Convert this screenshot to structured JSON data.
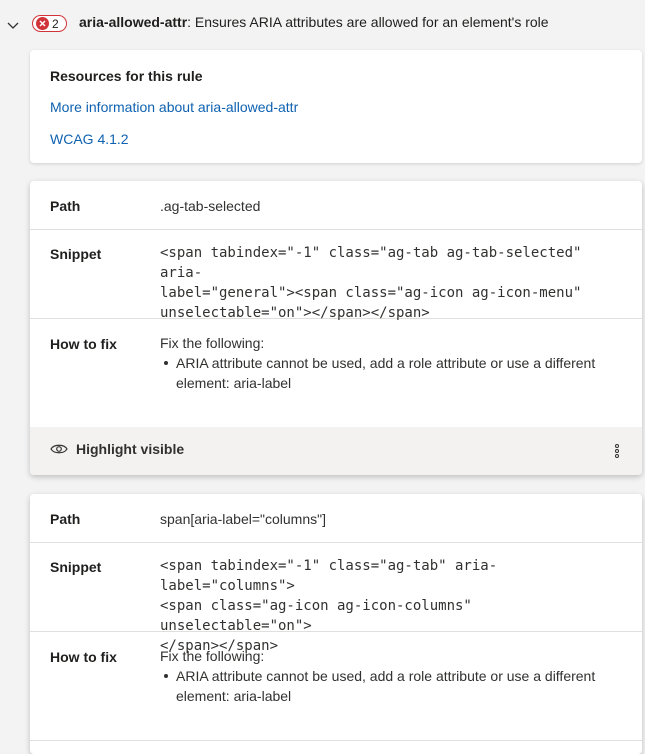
{
  "rule": {
    "id": "aria-allowed-attr",
    "description": ": Ensures ARIA attributes are allowed for an element's role",
    "count": "2",
    "chevron_icon": "chevron-down-icon",
    "error_icon": "error-x-icon"
  },
  "resources": {
    "heading": "Resources for this rule",
    "links": [
      "More information about aria-allowed-attr",
      "WCAG 4.1.2"
    ]
  },
  "labels": {
    "path": "Path",
    "snippet": "Snippet",
    "how_to_fix": "How to fix",
    "highlight": "Highlight visible"
  },
  "instances": [
    {
      "path": ".ag-tab-selected",
      "snippet": "<span tabindex=\"-1\" class=\"ag-tab ag-tab-selected\" aria-\nlabel=\"general\"><span class=\"ag-icon ag-icon-menu\"\nunselectable=\"on\"></span></span>",
      "fix_intro": "Fix the following:",
      "fix_items": [
        "ARIA attribute cannot be used, add a role attribute or use a different element: aria-label"
      ]
    },
    {
      "path": "span[aria-label=\"columns\"]",
      "snippet": "<span tabindex=\"-1\" class=\"ag-tab\" aria-label=\"columns\">\n<span class=\"ag-icon ag-icon-columns\" unselectable=\"on\">\n</span></span>",
      "fix_intro": "Fix the following:",
      "fix_items": [
        "ARIA attribute cannot be used, add a role attribute or use a different element: aria-label"
      ]
    }
  ],
  "colors": {
    "error": "#d13438",
    "link": "#0f62b1",
    "background": "#f3f3f3"
  }
}
